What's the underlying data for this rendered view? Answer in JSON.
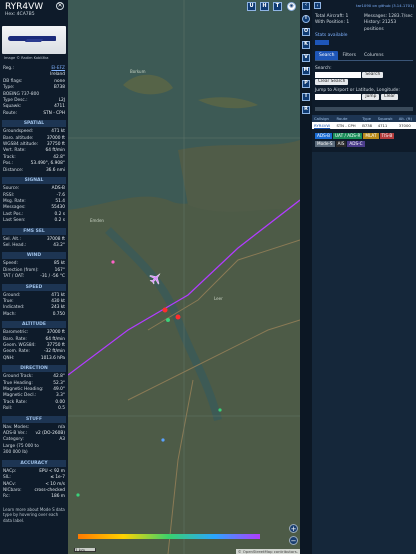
{
  "info": {
    "registration": "RYR4VW",
    "hex": "Hex:  4CA7B5",
    "photo_credit": "Image © Radim Koblížka",
    "rows1": [
      {
        "k": "Reg.:",
        "v": "EI-EFZ",
        "link": true
      },
      {
        "k": "",
        "v": "Ireland"
      },
      {
        "k": "DB flags:",
        "v": "none"
      },
      {
        "k": "Type:",
        "v": "B738"
      },
      {
        "k": "BOEING 737-800",
        "v": ""
      },
      {
        "k": "Type Desc.:",
        "v": "L2J"
      },
      {
        "k": "Squawk:",
        "v": "4711"
      },
      {
        "k": "Route:",
        "v": "STN - CPH"
      }
    ],
    "spatial_title": "SPATIAL",
    "spatial": [
      {
        "k": "Groundspeed:",
        "v": "471 kt"
      },
      {
        "k": "Baro. altitude:",
        "v": "37000 ft"
      },
      {
        "k": "WGS84 altitude:",
        "v": "37750 ft"
      },
      {
        "k": "Vert. Rate:",
        "v": "64 ft/min"
      },
      {
        "k": "Track:",
        "v": "42.8°"
      },
      {
        "k": "Pos.:",
        "v": "53.490°, 6.908°"
      },
      {
        "k": "Distance:",
        "v": "36.6 nmi"
      }
    ],
    "signal_title": "SIGNAL",
    "signal": [
      {
        "k": "Source:",
        "v": "ADS-B"
      },
      {
        "k": "RSSI:",
        "v": "-7.6"
      },
      {
        "k": "Msg. Rate:",
        "v": "51.4"
      },
      {
        "k": "Messages:",
        "v": "55430"
      },
      {
        "k": "Last Pos.:",
        "v": "0.2 s"
      },
      {
        "k": "Last Seen:",
        "v": "0.2 s"
      }
    ],
    "fms_title": "FMS SEL",
    "fms": [
      {
        "k": "Sel. Alt.:",
        "v": "37008 ft"
      },
      {
        "k": "Sel. Head.:",
        "v": "43.2°"
      }
    ],
    "wind_title": "WIND",
    "wind": [
      {
        "k": "Speed:",
        "v": "85 kt"
      },
      {
        "k": "Direction (from):",
        "v": "167°"
      },
      {
        "k": "TAT / OAT:",
        "v": "-31 / -56 °C"
      }
    ],
    "speed_title": "SPEED",
    "speed": [
      {
        "k": "Ground:",
        "v": "471 kt"
      },
      {
        "k": "True:",
        "v": "430 kt"
      },
      {
        "k": "Indicated:",
        "v": "243 kt"
      },
      {
        "k": "Mach:",
        "v": "0.750"
      }
    ],
    "altitude_title": "ALTITUDE",
    "altitude": [
      {
        "k": "Barometric:",
        "v": "37000 ft"
      },
      {
        "k": "Baro. Rate:",
        "v": "64 ft/min"
      },
      {
        "k": "Geom. WGS84:",
        "v": "37750 ft"
      },
      {
        "k": "Geom. Rate:",
        "v": "-32 ft/min"
      },
      {
        "k": "QNH:",
        "v": "1013.6 hPa"
      }
    ],
    "direction_title": "DIRECTION",
    "direction": [
      {
        "k": "Ground Track:",
        "v": "42.8°"
      },
      {
        "k": "True Heading:",
        "v": "52.3°"
      },
      {
        "k": "Magnetic Heading:",
        "v": "49.0°"
      },
      {
        "k": "Magnetic Decl.:",
        "v": "3.3°"
      },
      {
        "k": "Track Rate:",
        "v": "0.00"
      },
      {
        "k": "Roll:",
        "v": "0.5"
      }
    ],
    "stuff_title": "STUFF",
    "stuff": [
      {
        "k": "Nav. Modes:",
        "v": "n/a"
      },
      {
        "k": "ADS-B Ver.:",
        "v": "v2 (DO-260B)"
      },
      {
        "k": "Category:",
        "v": "A3"
      },
      {
        "k": "Large (75 000 to",
        "v": ""
      },
      {
        "k": "300 000 lb)",
        "v": ""
      }
    ],
    "accuracy_title": "ACCURACY",
    "accuracy": [
      {
        "k": "NACp:",
        "v": "EPU < 92 m"
      },
      {
        "k": "SIL:",
        "v": "≤ 1e-7"
      },
      {
        "k": "NACv:",
        "v": "< 10 m/s"
      },
      {
        "k": "NICbaro:",
        "v": "cross-checked"
      },
      {
        "k": "Rc:",
        "v": "186 m"
      }
    ],
    "note": "Learn more about Mode S data type by hovering over each data label."
  },
  "map": {
    "top_buttons": [
      "U",
      "H",
      "T"
    ],
    "labels": [
      "Borkum",
      "Emden",
      "Leer"
    ],
    "scale": "1 km",
    "attribution": "© OpenStreetMap contributors."
  },
  "tools": [
    "‹",
    "i",
    "O",
    "K",
    "V",
    "M",
    "P",
    "I",
    "R"
  ],
  "side": {
    "link": "tar1090 on github (3.14.1701)",
    "stats": {
      "total_label": "Total Aircraft: 1",
      "messages_label": "Messages: 1283.7/sec",
      "withpos_label": "With Position: 1",
      "history_label": "History: 21253 positions",
      "stats_label": "Stats available"
    },
    "tabs": [
      "Search",
      "Filters",
      "Columns"
    ],
    "search_label": "Search:",
    "search_btn": "Search",
    "clear_search": "Clear Search",
    "jump_label": "Jump to Airport or Latitude, Longitude:",
    "jump_btn": "Jump",
    "clear_btn": "Clear",
    "table_headers": [
      "Callsign",
      "Route",
      "Type",
      "Squawk",
      "Alt. (ft)"
    ],
    "table_row": [
      "RYR4VW",
      "STN - CPH",
      "B738",
      "4711",
      "37000"
    ],
    "badges": [
      {
        "t": "ADS-B",
        "c": "#1a6bd1"
      },
      {
        "t": "UAT / ADS-R",
        "c": "#1a8d5a"
      },
      {
        "t": "MLAT",
        "c": "#b88a1a"
      },
      {
        "t": "TIS-B",
        "c": "#b33d3d"
      },
      {
        "t": "Mode-S",
        "c": "#5a6a7a"
      },
      {
        "t": "AIS",
        "c": "#2a2a2a"
      },
      {
        "t": "ADS-C",
        "c": "#4a3c8a"
      }
    ]
  },
  "colors": {
    "panel": "#0e1b2a",
    "accent": "#1e56b8",
    "track": "#b13cff"
  }
}
